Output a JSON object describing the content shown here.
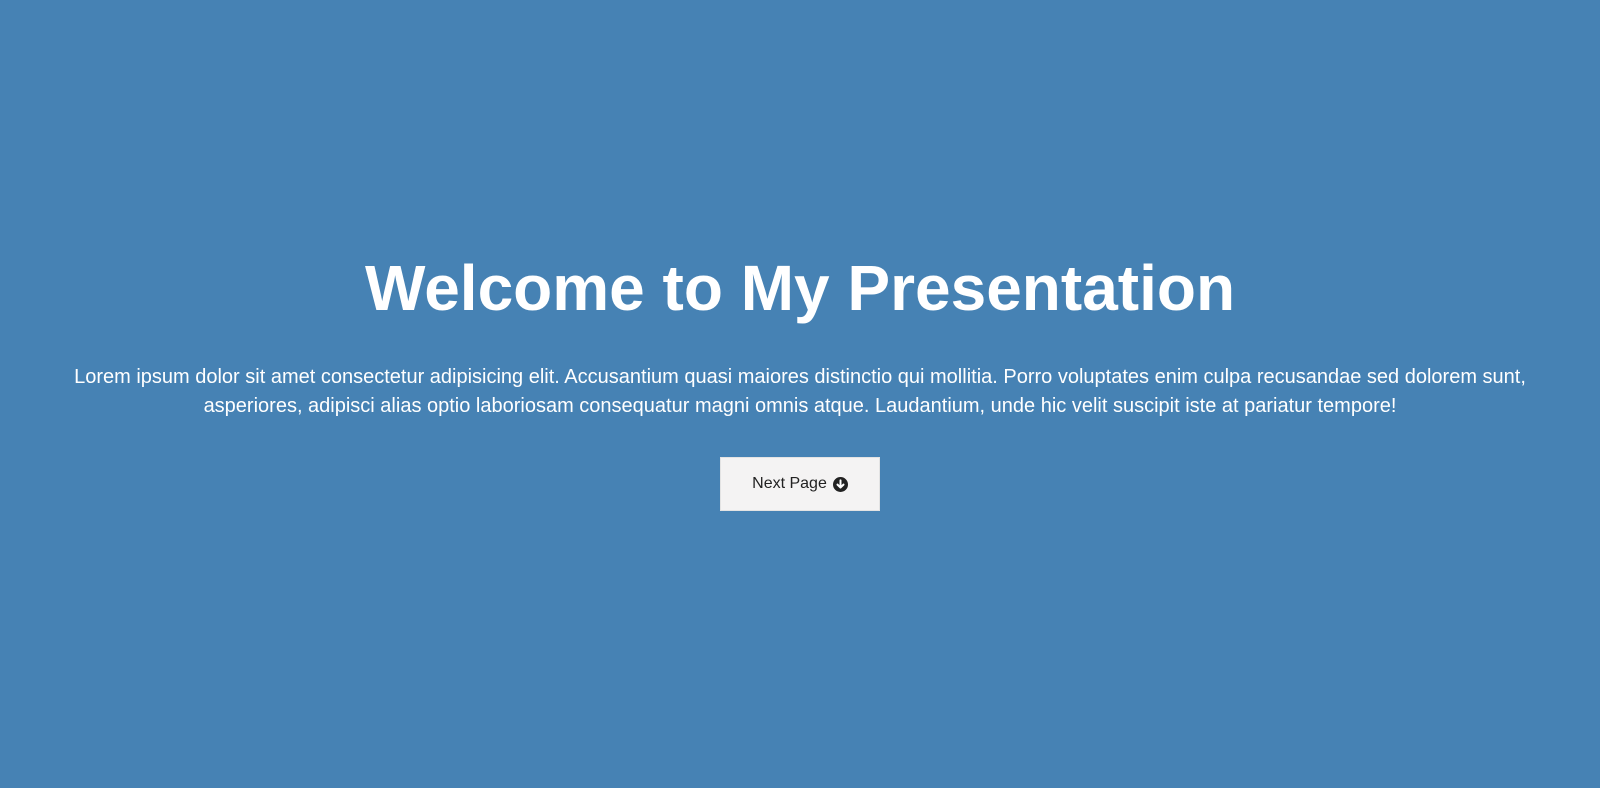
{
  "hero": {
    "title": "Welcome to My Presentation",
    "description": "Lorem ipsum dolor sit amet consectetur adipisicing elit. Accusantium quasi maiores distinctio qui mollitia. Porro voluptates enim culpa recusandae sed dolorem sunt, asperiores, adipisci alias optio laboriosam consequatur magni omnis atque. Laudantium, unde hic velit suscipit iste at pariatur tempore!",
    "button_label": "Next Page",
    "button_icon": "arrow-circle-down-icon"
  },
  "colors": {
    "background": "#4682b4",
    "title_text": "#ffffff",
    "button_background": "#f4f3f3",
    "button_text": "#222222"
  }
}
